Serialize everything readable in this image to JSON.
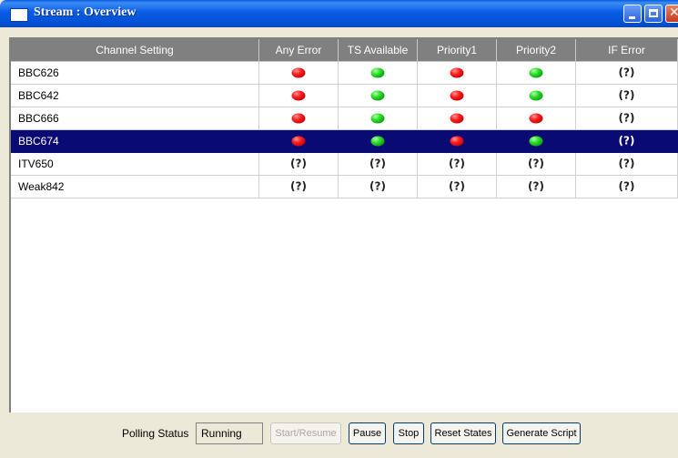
{
  "window": {
    "title": "Stream : Overview"
  },
  "grid": {
    "columns": [
      "Channel Setting",
      "Any Error",
      "TS Available",
      "Priority1",
      "Priority2",
      "IF Error"
    ],
    "rows": [
      {
        "name": "BBC626",
        "status": [
          "red",
          "green",
          "red",
          "green",
          "unknown"
        ],
        "selected": false
      },
      {
        "name": "BBC642",
        "status": [
          "red",
          "green",
          "red",
          "green",
          "unknown"
        ],
        "selected": false
      },
      {
        "name": "BBC666",
        "status": [
          "red",
          "green",
          "red",
          "red",
          "unknown"
        ],
        "selected": false
      },
      {
        "name": "BBC674",
        "status": [
          "red",
          "green",
          "red",
          "green",
          "unknown"
        ],
        "selected": true
      },
      {
        "name": "ITV650",
        "status": [
          "unknown",
          "unknown",
          "unknown",
          "unknown",
          "unknown"
        ],
        "selected": false
      },
      {
        "name": "Weak842",
        "status": [
          "unknown",
          "unknown",
          "unknown",
          "unknown",
          "unknown"
        ],
        "selected": false
      }
    ],
    "unknown_glyph": "(?)"
  },
  "status_colors": {
    "red": "#ee2222",
    "green": "#22cc22",
    "selected_row": "#0a0a74",
    "header": "#808080"
  },
  "footer": {
    "polling_label": "Polling Status",
    "polling_value": "Running",
    "buttons": [
      {
        "label": "Start/Resume",
        "enabled": false
      },
      {
        "label": "Pause",
        "enabled": true
      },
      {
        "label": "Stop",
        "enabled": true
      },
      {
        "label": "Reset States",
        "enabled": true
      },
      {
        "label": "Generate Script",
        "enabled": true
      }
    ]
  }
}
